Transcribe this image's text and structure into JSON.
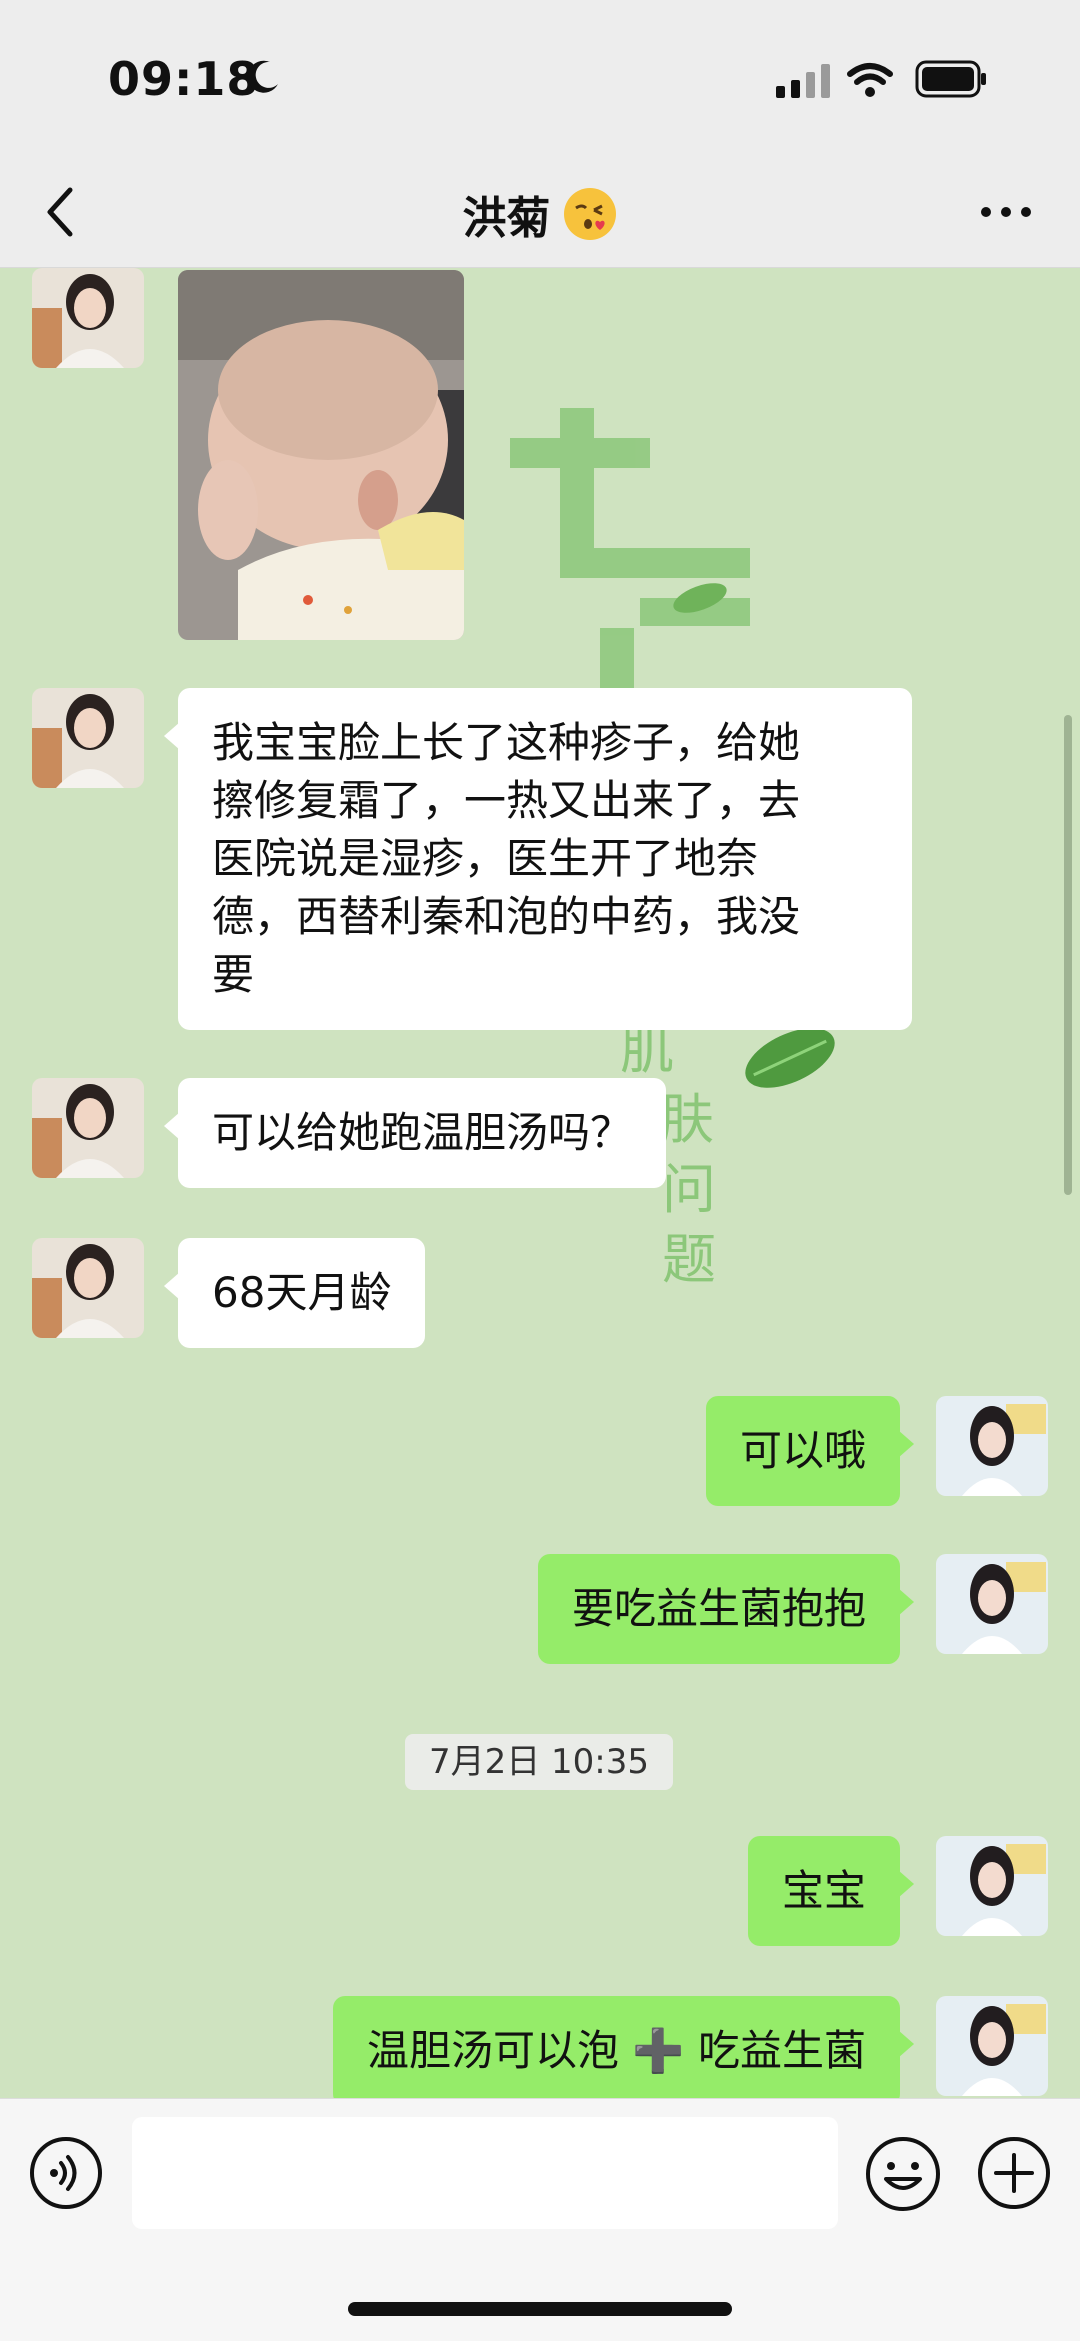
{
  "status_bar": {
    "time": "09:18",
    "moon_icon": "moon-icon",
    "signal_icon": "cellular-signal-icon",
    "wifi_icon": "wifi-icon",
    "battery_icon": "battery-icon"
  },
  "header": {
    "title": "洪菊",
    "title_emoji": "kissing-face-emoji",
    "back_icon": "chevron-left-icon",
    "more_icon": "ellipsis-icon"
  },
  "background": {
    "large_text_top": "七老",
    "large_text_side": [
      "肌",
      "肤",
      "问",
      "题"
    ],
    "small_text": "skin problems",
    "accent_color": "#7cb96a"
  },
  "messages": [
    {
      "side": "in",
      "type": "image",
      "description_icon": "baby-photo"
    },
    {
      "side": "in",
      "type": "text",
      "lines": [
        "我宝宝脸上长了这种疹子，给她",
        "擦修复霜了，一热又出来了，去",
        "医院说是湿疹，医生开了地奈",
        "德，西替利秦和泡的中药，我没",
        "要"
      ]
    },
    {
      "side": "in",
      "type": "text",
      "text": "可以给她跑温胆汤吗？"
    },
    {
      "side": "in",
      "type": "text",
      "text": "68天月龄"
    },
    {
      "side": "out",
      "type": "text",
      "text": "可以哦"
    },
    {
      "side": "out",
      "type": "text",
      "text": "要吃益生菌抱抱"
    },
    {
      "side": "out",
      "type": "text",
      "text": "宝宝"
    },
    {
      "side": "out",
      "type": "text",
      "text": "温胆汤可以泡 ➕ 吃益生菌"
    }
  ],
  "timestamp": "7月2日 10:35",
  "input_bar": {
    "voice_icon": "voice-icon",
    "input_value": "",
    "emoji_icon": "smiley-icon",
    "plus_icon": "plus-circle-icon"
  },
  "colors": {
    "chat_bg": "#cfe3c0",
    "outgoing_bubble": "#95ec69",
    "incoming_bubble": "#ffffff",
    "header_bg": "#ededed"
  }
}
